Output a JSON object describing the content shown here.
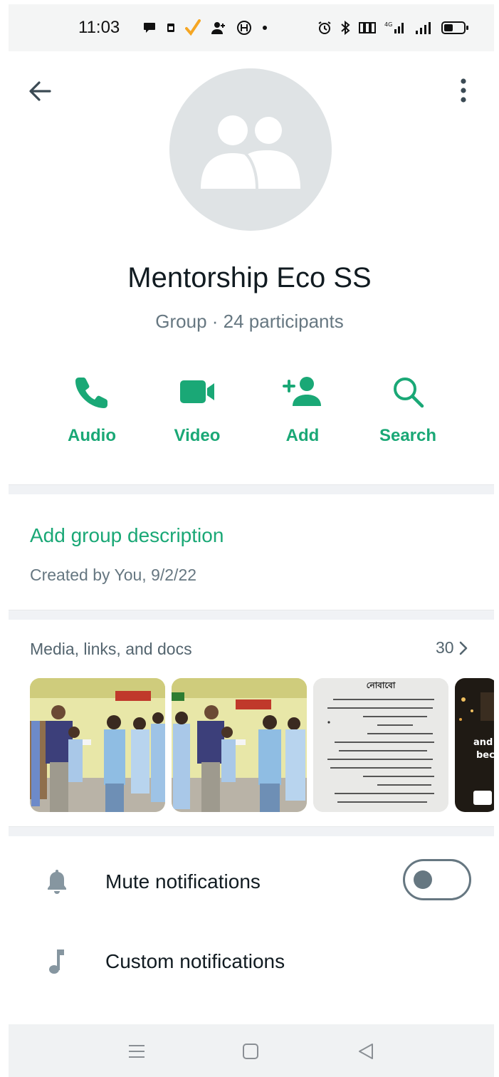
{
  "status_bar": {
    "time": "11:03",
    "left_icons": [
      "chat-bubble-icon",
      "sim-icon",
      "check-icon",
      "person-add-icon",
      "circle-h-icon",
      "dot-icon"
    ],
    "right_icons": [
      "alarm-icon",
      "bluetooth-icon",
      "data-icon",
      "4g-signal-icon",
      "signal-icon",
      "battery-icon"
    ],
    "check_color": "#f5a623"
  },
  "header": {
    "group_name": "Mentorship Eco SS",
    "meta": "Group · 24 participants"
  },
  "actions": [
    {
      "label": "Audio",
      "icon": "phone-icon"
    },
    {
      "label": "Video",
      "icon": "video-icon"
    },
    {
      "label": "Add",
      "icon": "add-person-icon"
    },
    {
      "label": "Search",
      "icon": "search-icon"
    }
  ],
  "description": {
    "add_label": "Add group description",
    "created_by": "Created by You, 9/2/22"
  },
  "media": {
    "title": "Media, links, and docs",
    "count": "30",
    "thumbnails": [
      {
        "kind": "photo",
        "alt": "group photo"
      },
      {
        "kind": "photo",
        "alt": "group photo"
      },
      {
        "kind": "document",
        "heading": "নোবাবো"
      },
      {
        "kind": "video",
        "caption_line1": "and y",
        "caption_line2": "beco"
      }
    ]
  },
  "settings": [
    {
      "label": "Mute notifications",
      "icon": "bell-icon",
      "has_toggle": true,
      "toggle_on": false
    },
    {
      "label": "Custom notifications",
      "icon": "music-note-icon",
      "has_toggle": false
    }
  ],
  "colors": {
    "accent": "#1aa876",
    "secondary_text": "#667781",
    "avatar_bg": "#dfe3e5"
  }
}
